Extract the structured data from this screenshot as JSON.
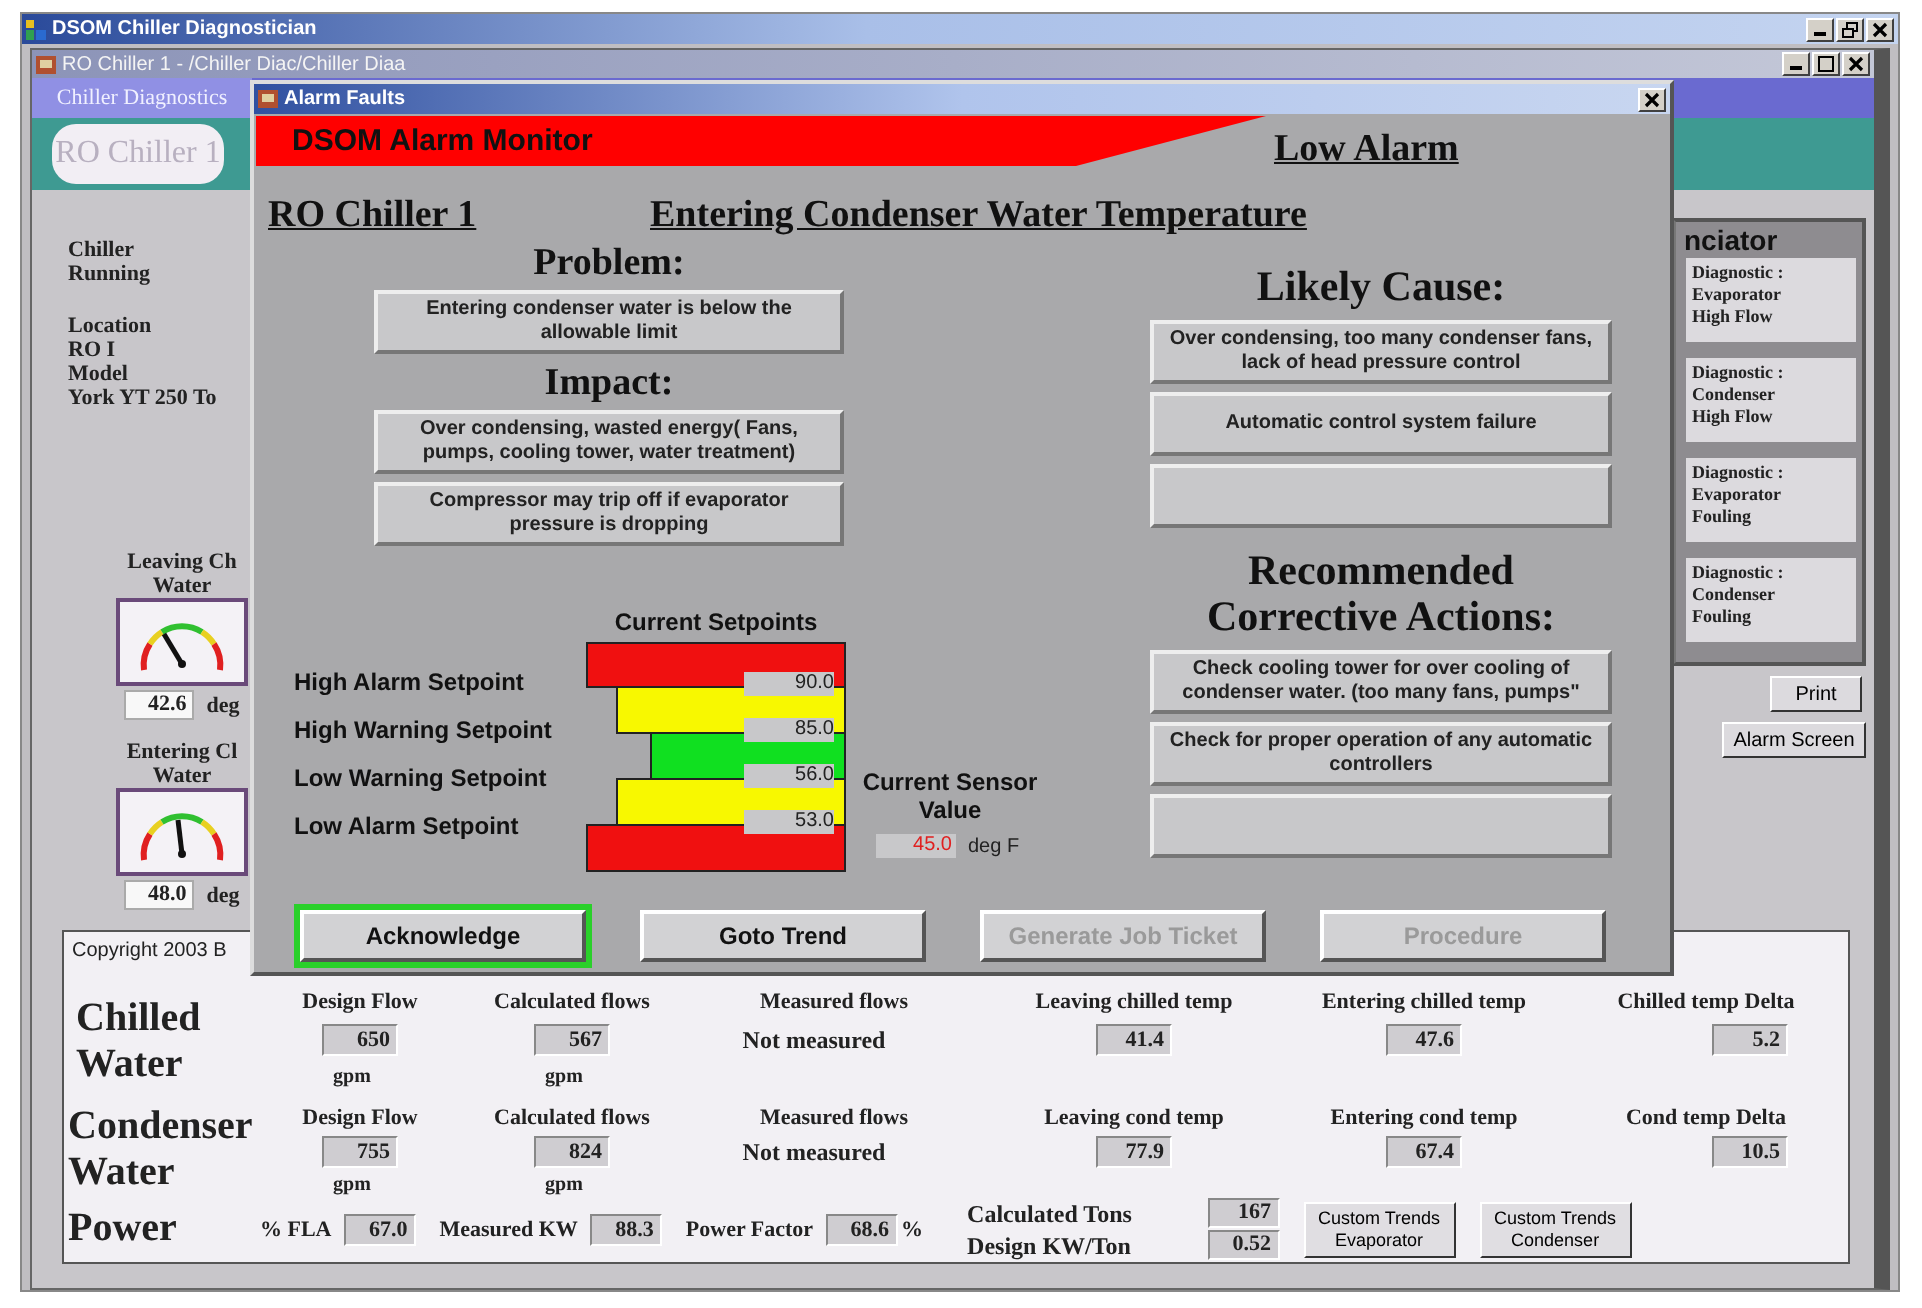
{
  "app_window": {
    "title": "DSOM Chiller Diagnostician"
  },
  "document_window": {
    "title": "RO Chiller 1 - /Chiller Diac/Chiller Diaa"
  },
  "tab": {
    "label": "Chiller Diagnostics",
    "selected": true
  },
  "chiller_badge": "RO Chiller 1",
  "info": [
    {
      "label": "Chiller",
      "value": "Running"
    },
    {
      "label": "Location",
      "value": "RO I"
    },
    {
      "label": "Model",
      "value": "York YT 250 To"
    }
  ],
  "gauges": [
    {
      "caption_lines": [
        "Leaving Ch",
        "Water"
      ],
      "reading": "42.6",
      "unit": "deg"
    },
    {
      "caption_lines": [
        "Entering Cl",
        "Water"
      ],
      "reading": "48.0",
      "unit": "deg"
    }
  ],
  "annunciator": {
    "title": "nciator",
    "items": [
      {
        "lines": [
          "Diagnostic :",
          "Evaporator",
          "High Flow"
        ]
      },
      {
        "lines": [
          "Diagnostic :",
          "Condenser",
          "High Flow"
        ]
      },
      {
        "lines": [
          "Diagnostic :",
          "Evaporator",
          "Fouling"
        ]
      },
      {
        "lines": [
          "Diagnostic :",
          "Condenser",
          "Fouling"
        ]
      }
    ]
  },
  "side_buttons": [
    "Print",
    "Alarm Screen"
  ],
  "bottom_panel": {
    "copyright": "Copyright 2003 B",
    "sections": [
      {
        "title": "Chilled Water",
        "columns": [
          {
            "kind": "boxed",
            "header": "Design Flow",
            "value": "650",
            "unit": "gpm"
          },
          {
            "kind": "boxed",
            "header": "Calculated flows",
            "value": "567",
            "unit": "gpm"
          },
          {
            "kind": "plain",
            "header": "Measured flows",
            "value": "Not measured"
          },
          {
            "kind": "boxed",
            "header": "Leaving chilled temp",
            "value": "41.4"
          },
          {
            "kind": "boxed",
            "header": "Entering chilled temp",
            "value": "47.6"
          },
          {
            "kind": "boxed",
            "header": "Chilled temp Delta",
            "value": "5.2"
          }
        ]
      },
      {
        "title": "Condenser Water",
        "columns": [
          {
            "kind": "boxed",
            "header": "Design Flow",
            "value": "755",
            "unit": "gpm"
          },
          {
            "kind": "boxed",
            "header": "Calculated flows",
            "value": "824",
            "unit": "gpm"
          },
          {
            "kind": "plain",
            "header": "Measured flows",
            "value": "Not measured"
          },
          {
            "kind": "boxed",
            "header": "Leaving cond temp",
            "value": "77.9"
          },
          {
            "kind": "boxed",
            "header": "Entering cond temp",
            "value": "67.4"
          },
          {
            "kind": "boxed",
            "header": "Cond temp Delta",
            "value": "10.5"
          }
        ]
      }
    ],
    "power": {
      "title": "Power",
      "items": [
        {
          "label": "% FLA",
          "value": "67.0"
        },
        {
          "label": "Measured KW",
          "value": "88.3"
        },
        {
          "label": "Power Factor",
          "value": "68.6",
          "unit": "%"
        }
      ],
      "tons": [
        {
          "label": "Calculated Tons",
          "value": "167"
        },
        {
          "label": "Design KW/Ton",
          "value": "0.52"
        }
      ],
      "buttons": [
        "Custom Trends Evaporator",
        "Custom Trends Condenser"
      ]
    }
  },
  "dialog": {
    "title": "Alarm Faults",
    "banner": "DSOM Alarm Monitor",
    "severity": "Low Alarm",
    "equipment": "RO Chiller 1",
    "point": "Entering Condenser Water Temperature",
    "problem": {
      "heading": "Problem:",
      "boxes": [
        {
          "kind": "text",
          "text": "Entering condenser water is below the allowable limit"
        }
      ]
    },
    "impact": {
      "heading": "Impact:",
      "boxes": [
        {
          "kind": "text",
          "text": "Over condensing, wasted energy( Fans, pumps, cooling tower, water treatment)"
        },
        {
          "kind": "text",
          "text": "Compressor may trip off if evaporator pressure is dropping"
        }
      ]
    },
    "cause": {
      "heading": "Likely Cause:",
      "boxes": [
        {
          "kind": "text",
          "text": "Over condensing, too many condenser fans, lack of head pressure control"
        },
        {
          "kind": "text",
          "text": "Automatic control system failure"
        },
        {
          "kind": "blank"
        }
      ]
    },
    "actions": {
      "heading": "Recommended Corrective Actions:",
      "boxes": [
        {
          "kind": "text",
          "text": "Check cooling tower for over cooling of condenser water. (too many fans, pumps\""
        },
        {
          "kind": "text",
          "text": "Check for proper operation of any automatic controllers"
        },
        {
          "kind": "blank"
        }
      ]
    },
    "setpoints": {
      "title": "Current Setpoints",
      "items": [
        {
          "label": "High Alarm Setpoint",
          "value": "90.0"
        },
        {
          "label": "High Warning Setpoint",
          "value": "85.0"
        },
        {
          "label": "Low Warning Setpoint",
          "value": "56.0"
        },
        {
          "label": "Low Alarm Setpoint",
          "value": "53.0"
        }
      ]
    },
    "sensor": {
      "label": "Current Sensor Value",
      "value": "45.0",
      "unit": "deg F"
    },
    "buttons": [
      {
        "label": "Acknowledge",
        "focused": true,
        "disabled": false
      },
      {
        "label": "Goto Trend",
        "focused": false,
        "disabled": false
      },
      {
        "label": "Generate Job Ticket",
        "focused": false,
        "disabled": true
      },
      {
        "label": "Procedure",
        "focused": false,
        "disabled": true
      }
    ]
  }
}
